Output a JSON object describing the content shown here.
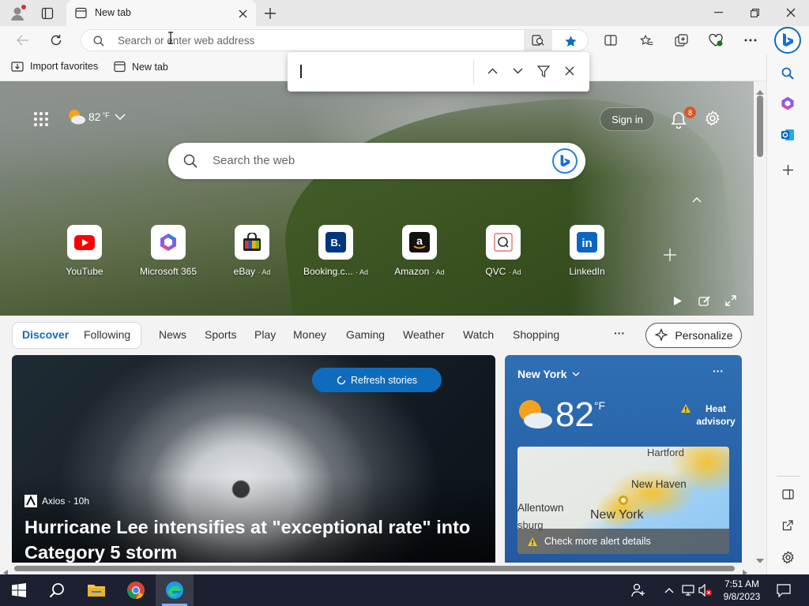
{
  "browser": {
    "tab_title": "New tab",
    "address_placeholder": "Search or enter web address",
    "bookmarks": [
      "Import favorites",
      "New tab"
    ]
  },
  "find_bar": {
    "value": ""
  },
  "hero": {
    "temperature": "82",
    "temp_unit": "°F",
    "sign_in": "Sign in",
    "notification_count": "8",
    "search_placeholder": "Search the web",
    "tiles": [
      {
        "label": "YouTube",
        "ad": ""
      },
      {
        "label": "Microsoft 365",
        "ad": ""
      },
      {
        "label": "eBay",
        "ad": "· Ad"
      },
      {
        "label": "Booking.c...",
        "ad": "· Ad"
      },
      {
        "label": "Amazon",
        "ad": "· Ad"
      },
      {
        "label": "QVC",
        "ad": "· Ad"
      },
      {
        "label": "LinkedIn",
        "ad": ""
      }
    ]
  },
  "feed": {
    "nav": [
      "Discover",
      "Following",
      "News",
      "Sports",
      "Play",
      "Money",
      "Gaming",
      "Weather",
      "Watch",
      "Shopping"
    ],
    "more": "···",
    "personalize": "Personalize",
    "refresh": "Refresh stories",
    "story": {
      "source": "Axios · 10h",
      "title": "Hurricane Lee intensifies at \"exceptional rate\" into Category 5 storm"
    },
    "weather": {
      "location": "New York",
      "temp": "82",
      "unit": "°F",
      "alert": "Heat advisory",
      "map_labels": [
        "Hartford",
        "New Haven",
        "Allentown",
        "New York",
        "sburg"
      ],
      "alert_details": "Check more alert details"
    }
  },
  "taskbar": {
    "time": "7:51 AM",
    "date": "9/8/2023"
  },
  "colors": {
    "accent": "#0f6cbd",
    "taskbar": "#1d2030",
    "weather_card": "#2b66ad"
  }
}
